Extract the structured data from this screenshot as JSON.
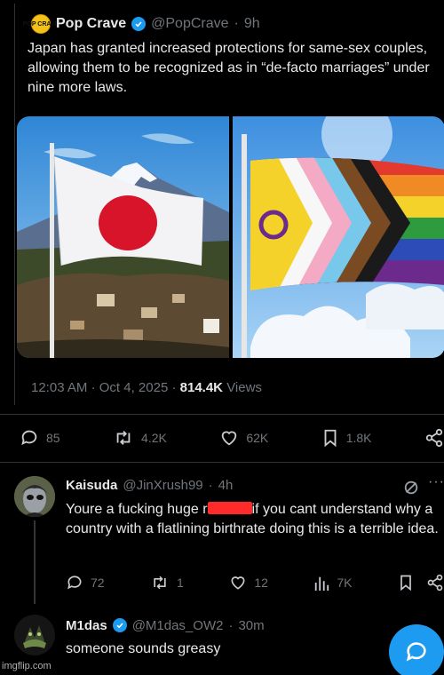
{
  "tweet": {
    "author_name": "Pop Crave",
    "author_handle": "@PopCrave",
    "age": "9h",
    "avatar_text": "POP CRAVE",
    "text": "Japan has granted increased protections for same-sex couples, allowing them to be recognized as in “de-facto marriages” under nine more laws.",
    "time": "12:03 AM",
    "date": "Oct 4, 2025",
    "views_count": "814.4K",
    "views_label": "Views",
    "replies": "85",
    "reposts": "4.2K",
    "likes": "62K",
    "bookmarks": "1.8K"
  },
  "replies": [
    {
      "author_name": "Kaisuda",
      "author_handle": "@JinXrush99",
      "age": "4h",
      "text_before": "Youre a fucking huge r",
      "text_after": "if you cant understand why a country with a flatlining birthrate doing this is a terrible idea.",
      "replies": "72",
      "reposts": "1",
      "likes": "12",
      "views": "7K"
    },
    {
      "author_name": "M1das",
      "author_handle": "@M1das_OW2",
      "age": "30m",
      "text": "someone sounds greasy"
    }
  ],
  "watermark": "imgflip.com",
  "colors": {
    "accent": "#1d9bf0",
    "text": "#e7e9ea",
    "muted": "#71767b",
    "background": "#000000",
    "redaction": "#ff2b2b"
  },
  "icons": {
    "reply": "speech-bubble-icon",
    "repost": "repost-arrows-icon",
    "like": "heart-icon",
    "bookmark": "bookmark-icon",
    "share": "share-icon",
    "views": "bar-chart-icon",
    "grok": "grok-icon",
    "more": "ellipsis-icon",
    "compose": "reply-fab-icon",
    "verified": "verified-badge-icon"
  }
}
